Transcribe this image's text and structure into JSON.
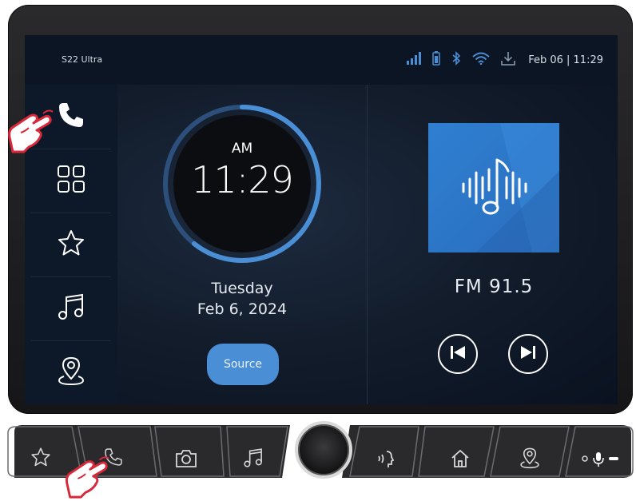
{
  "status_bar": {
    "device_name": "S22 Ultra",
    "date_time": "Feb 06 | 11:29",
    "icons": [
      "signal-icon",
      "battery-icon",
      "bluetooth-icon",
      "wifi-icon",
      "download-icon"
    ]
  },
  "sidebar": {
    "items": [
      {
        "name": "phone",
        "icon": "phone-icon"
      },
      {
        "name": "apps",
        "icon": "grid-icon"
      },
      {
        "name": "favorites",
        "icon": "star-icon"
      },
      {
        "name": "music",
        "icon": "music-note-icon"
      },
      {
        "name": "navigation",
        "icon": "map-pin-icon"
      }
    ]
  },
  "clock": {
    "ampm": "AM",
    "time": "11:29",
    "day": "Tuesday",
    "date": "Feb 6, 2024"
  },
  "source_button": {
    "label": "Source"
  },
  "radio": {
    "station": "FM  91.5"
  },
  "hardware_buttons": [
    "star-icon",
    "phone-icon",
    "camera-icon",
    "music-note-icon",
    "volume-knob",
    "voice-icon",
    "home-icon",
    "map-pin-icon",
    "mic-icon"
  ],
  "colors": {
    "accent": "#4a8fd6",
    "screen_bg": "#0b1624",
    "pointer_hand": "#d9283a"
  }
}
